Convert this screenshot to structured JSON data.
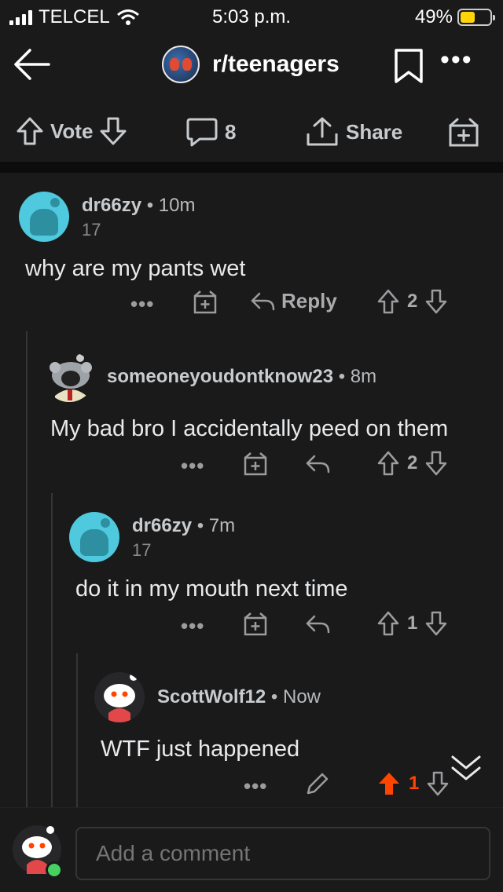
{
  "status_bar": {
    "carrier": "TELCEL",
    "time": "5:03 p.m.",
    "battery": "49%",
    "battery_level": 0.49
  },
  "header": {
    "subreddit": "r/teenagers",
    "back_icon": "arrow-left-icon",
    "bookmark_icon": "bookmark-icon",
    "more_label": "•••"
  },
  "post_actions": {
    "vote_label": "Vote",
    "comment_count": "8",
    "share_label": "Share"
  },
  "comments": [
    {
      "user": "dr66zy",
      "age": "10m",
      "karma": "17",
      "text": "why are my pants wet",
      "reply_label": "Reply",
      "votes": "2"
    },
    {
      "user": "someoneyoudontknow23",
      "age": "8m",
      "karma": "",
      "text": "My bad bro I accidentally peed on them",
      "votes": "2"
    },
    {
      "user": "dr66zy",
      "age": "7m",
      "karma": "17",
      "text": "do it in my mouth next time",
      "votes": "1"
    },
    {
      "user": "ScottWolf12",
      "age": "Now",
      "karma": "",
      "text": "WTF just happened",
      "votes": "1"
    }
  ],
  "composer": {
    "placeholder": "Add a comment"
  },
  "colors": {
    "background": "#1a1a1b",
    "upvote_active": "#ff4500",
    "online": "#46d160"
  }
}
